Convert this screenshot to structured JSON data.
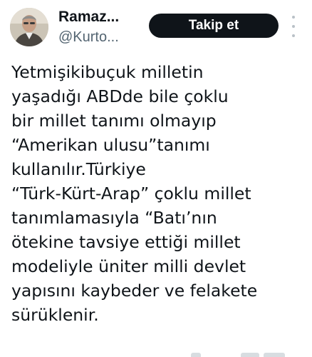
{
  "author": {
    "name": "Ramaz...",
    "handle": "@Kurto..."
  },
  "actions": {
    "follow_label": "Takip et",
    "more_icon": "more-vertical-icon"
  },
  "tweet": {
    "lines": [
      "Yetmişikibuçuk milletin",
      "yaşadığı ABDde bile çoklu",
      "bir millet tanımı olmayıp",
      "“Amerikan ulusu”tanımı",
      "kullanılır.Türkiye",
      "“Türk-Kürt-Arap” çoklu millet",
      "tanımlamasıyla “Batı’nın",
      "ötekine tavsiye ettiği millet",
      "modeliyle  üniter milli devlet",
      "yapısını kaybeder ve felakete",
      "sürüklenir."
    ]
  },
  "colors": {
    "text": "#0f1419",
    "secondary": "#536471",
    "button_bg": "#0f1419",
    "button_text": "#ffffff"
  }
}
